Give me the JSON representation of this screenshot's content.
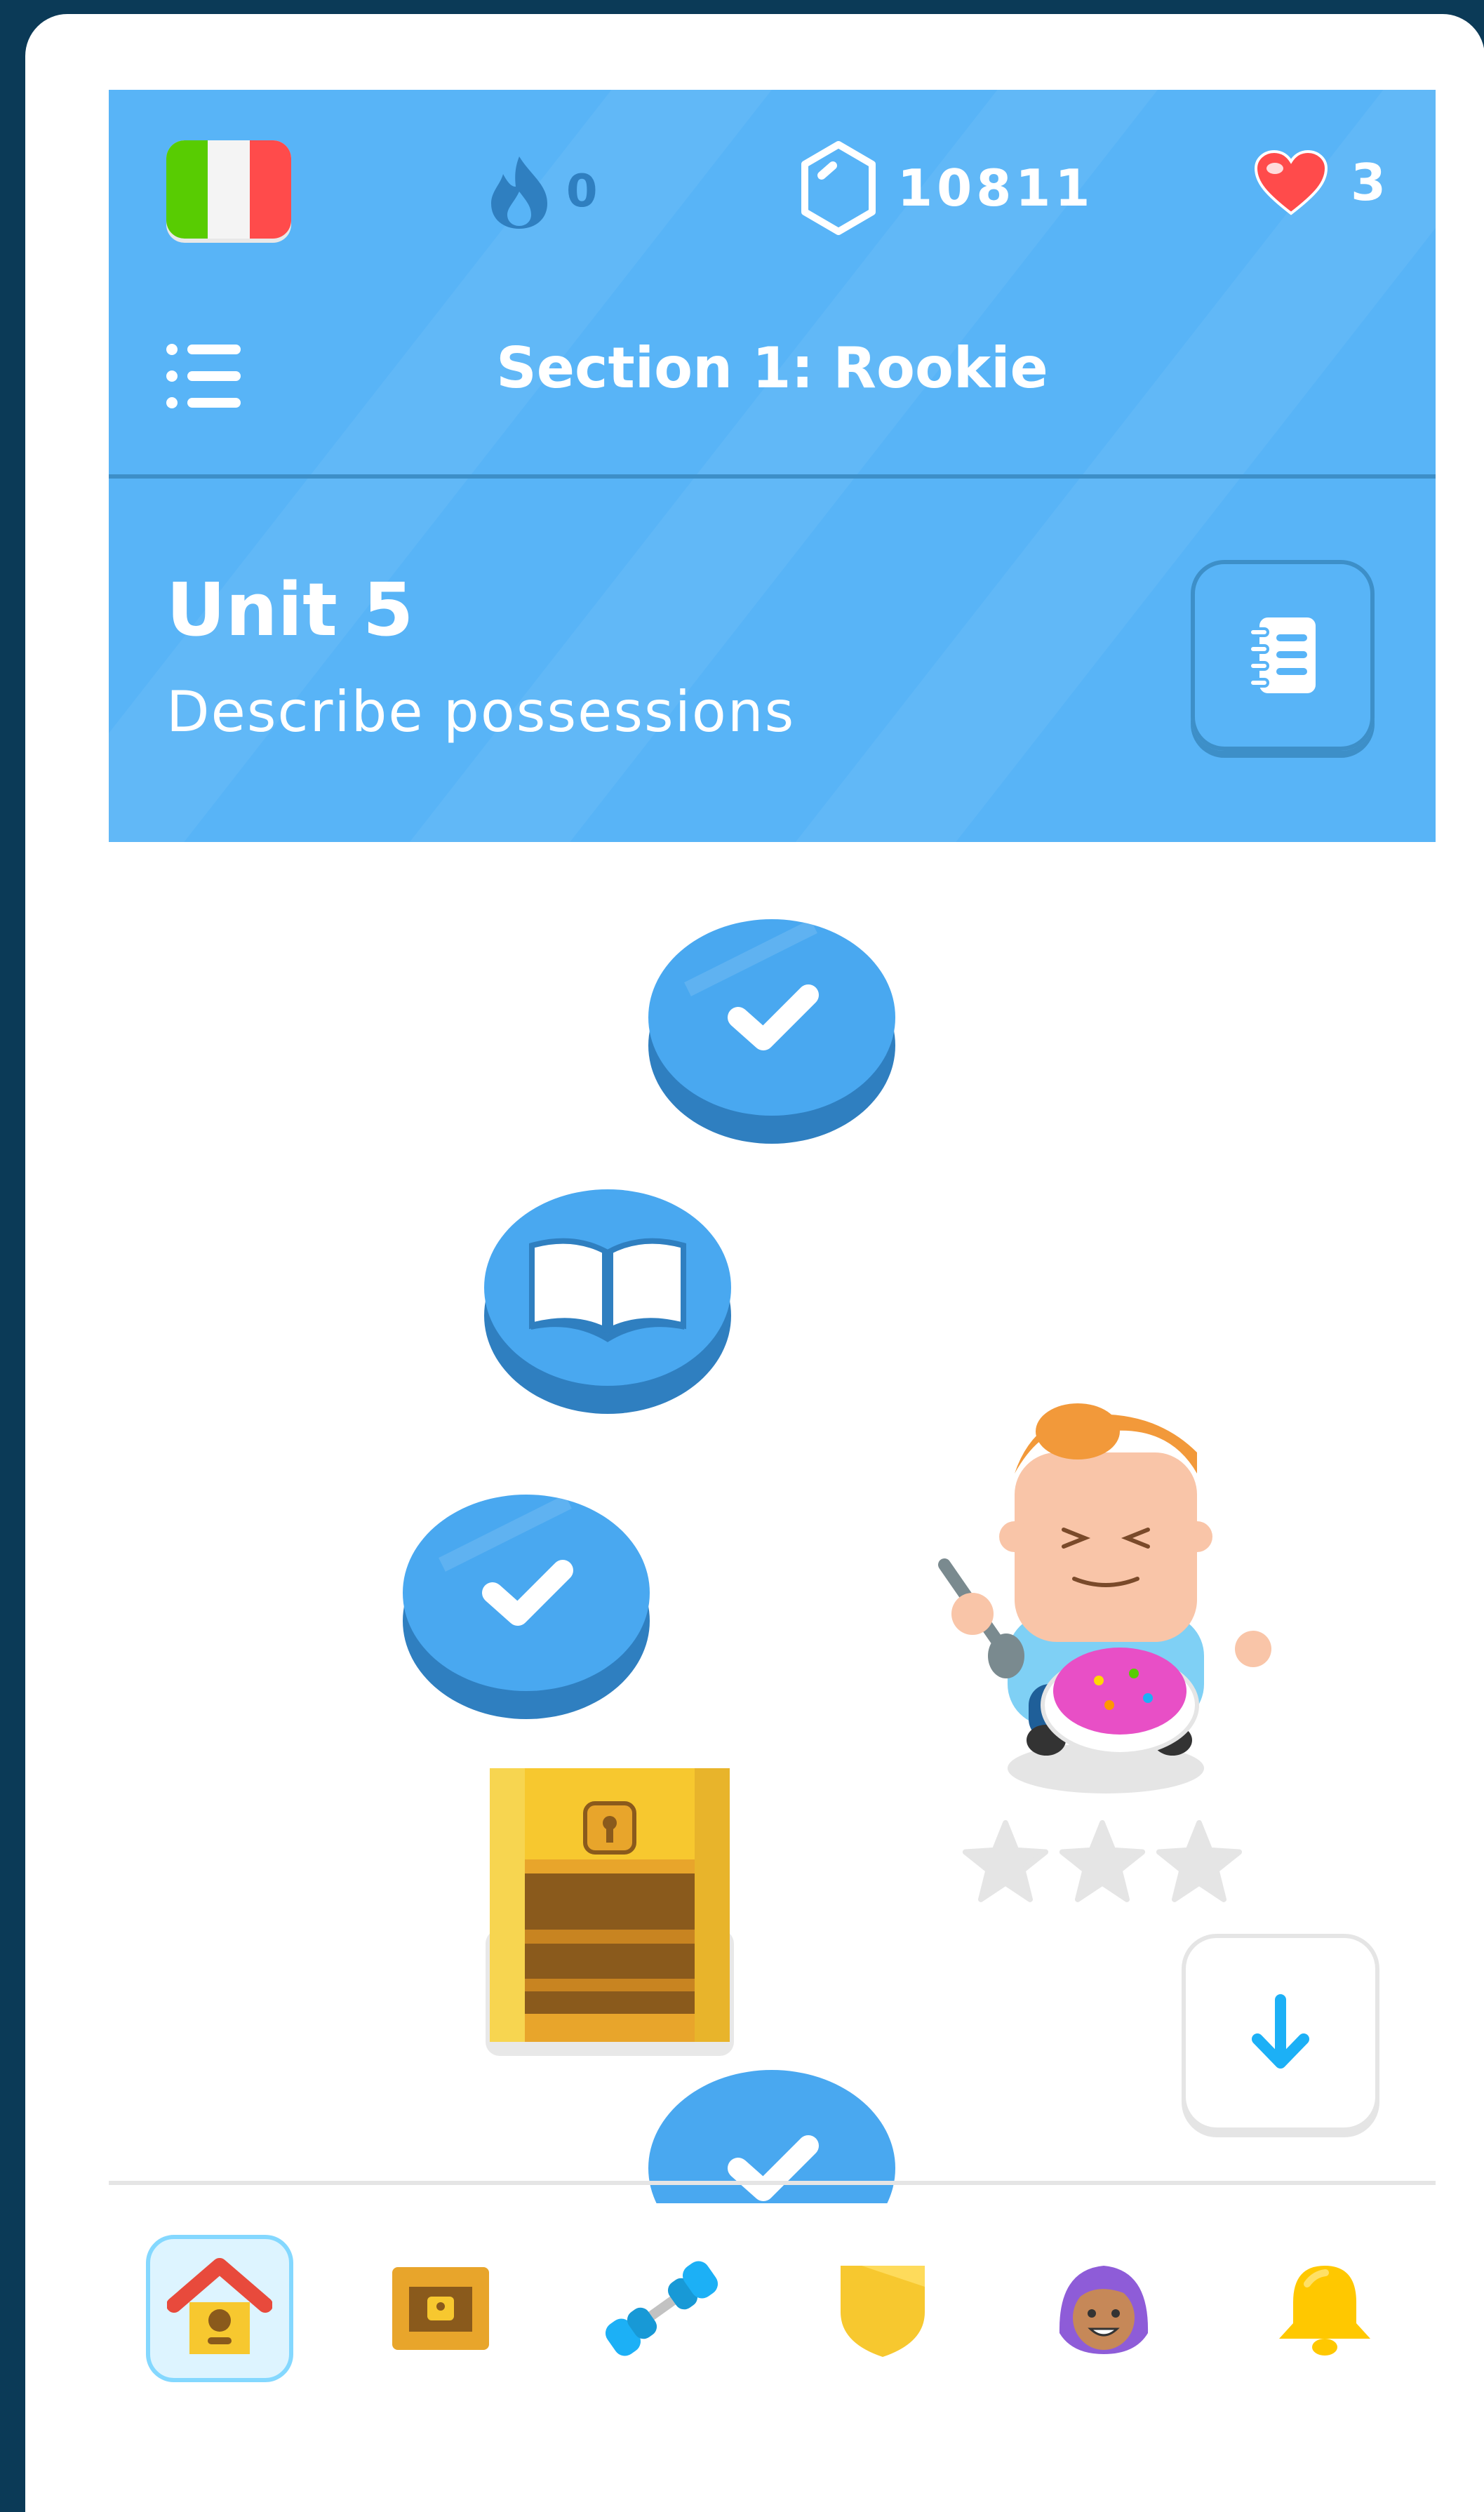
{
  "header": {
    "streak_count": "0",
    "gems_count": "10811",
    "hearts_count": "3",
    "section_title": "Section 1: Rookie",
    "unit_title": "Unit 5",
    "unit_subtitle": "Describe possessions"
  },
  "colors": {
    "header_bg": "#58b4f7",
    "header_dark": "#3d8fc8",
    "node_blue": "#49a8f0",
    "node_shadow": "#2f7fc0",
    "gold": "#f7c82f",
    "heart": "#ff4b4b",
    "frame_bg": "#0b3a57"
  },
  "path": {
    "nodes": [
      {
        "icon": "checkmark-icon",
        "status": "completed"
      },
      {
        "icon": "book-icon",
        "status": "completed"
      },
      {
        "icon": "checkmark-icon",
        "status": "completed"
      },
      {
        "icon": "treasure-chest-icon",
        "status": "open"
      },
      {
        "icon": "checkmark-icon",
        "status": "completed"
      }
    ],
    "stars_earned": 0,
    "stars_total": 3
  },
  "nav": {
    "items": [
      {
        "icon": "home-icon",
        "active": true
      },
      {
        "icon": "chest-icon",
        "active": false
      },
      {
        "icon": "dumbbell-icon",
        "active": false
      },
      {
        "icon": "shield-icon",
        "active": false
      },
      {
        "icon": "avatar-icon",
        "active": false
      },
      {
        "icon": "bell-icon",
        "active": false
      }
    ]
  }
}
